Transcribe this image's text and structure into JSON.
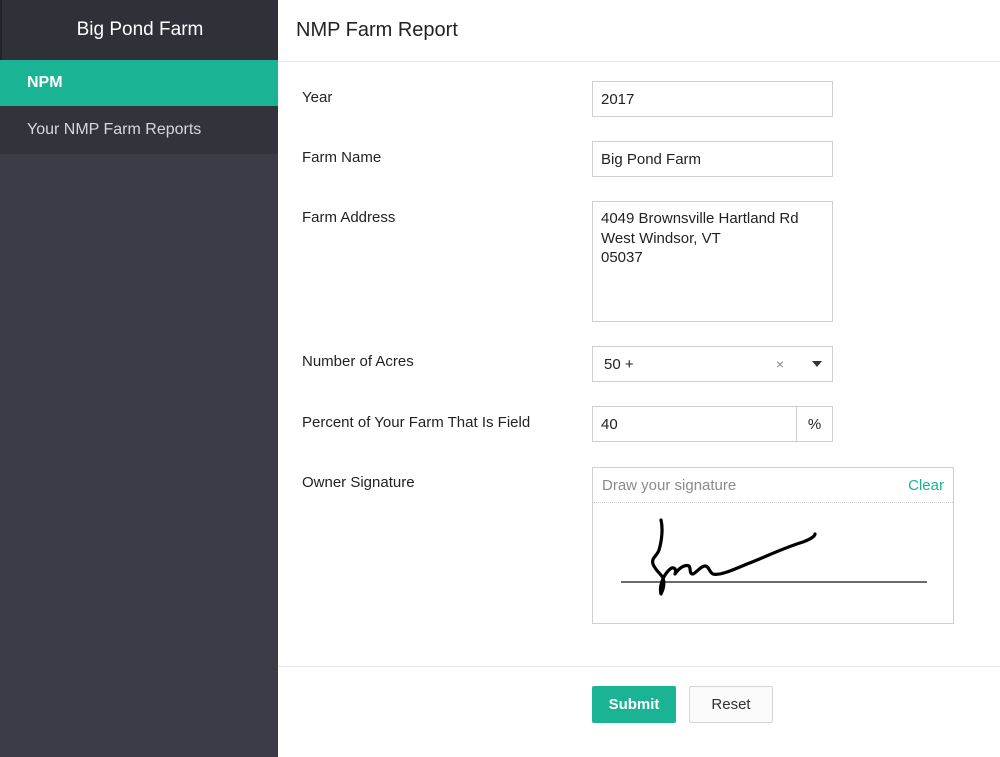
{
  "sidebar": {
    "brand": "Big Pond Farm",
    "items": [
      {
        "label": "NPM"
      },
      {
        "label": "Your NMP Farm Reports"
      }
    ]
  },
  "header": {
    "title": "NMP Farm Report"
  },
  "form": {
    "year": {
      "label": "Year",
      "value": "2017"
    },
    "farm_name": {
      "label": "Farm Name",
      "value": "Big Pond Farm"
    },
    "farm_address": {
      "label": "Farm Address",
      "lines": [
        "4049 Brownsville Hartland Rd",
        "West Windsor, VT",
        "05037"
      ]
    },
    "acres": {
      "label": "Number of Acres",
      "selected": "50 +",
      "clear_glyph": "×"
    },
    "percent_field": {
      "label": "Percent of Your Farm That Is Field",
      "value": "40",
      "addon": "%"
    },
    "signature": {
      "label": "Owner Signature",
      "placeholder": "Draw your signature",
      "clear_label": "Clear"
    }
  },
  "actions": {
    "submit_label": "Submit",
    "reset_label": "Reset"
  },
  "colors": {
    "accent": "#1ab394",
    "sidebar": "#3b3c45",
    "sidebar_header": "#2f3038"
  }
}
